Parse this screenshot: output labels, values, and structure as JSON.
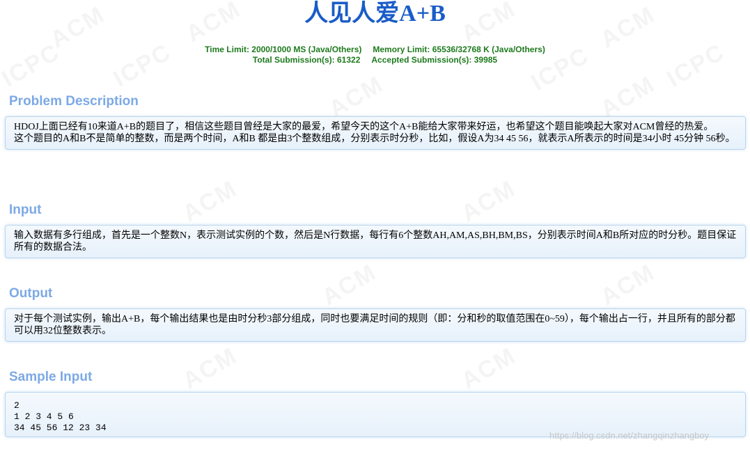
{
  "header": {
    "title": "人见人爱A+B",
    "time_limit": "Time Limit: 2000/1000 MS (Java/Others)",
    "memory_limit": "Memory Limit: 65536/32768 K (Java/Others)",
    "total_submissions": "Total Submission(s): 61322",
    "accepted_submissions": "Accepted Submission(s): 39985"
  },
  "description": {
    "title": "Problem Description",
    "line1": "HDOJ上面已经有10来道A+B的题目了，相信这些题目曾经是大家的最爱，希望今天的这个A+B能给大家带来好运，也希望这个题目能唤起大家对ACM曾经的热爱。",
    "line2": "这个题目的A和B不是简单的整数，而是两个时间，A和B 都是由3个整数组成，分别表示时分秒，比如，假设A为34 45 56，就表示A所表示的时间是34小时 45分钟 56秒。"
  },
  "input": {
    "title": "Input",
    "text": "输入数据有多行组成，首先是一个整数N，表示测试实例的个数，然后是N行数据，每行有6个整数AH,AM,AS,BH,BM,BS，分别表示时间A和B所对应的时分秒。题目保证所有的数据合法。"
  },
  "output": {
    "title": "Output",
    "text": "对于每个测试实例，输出A+B，每个输出结果也是由时分秒3部分组成，同时也要满足时间的规则（即：分和秒的取值范围在0~59），每个输出占一行，并且所有的部分都可以用32位整数表示。"
  },
  "sample_input": {
    "title": "Sample Input",
    "lines": [
      "2",
      "1 2 3 4 5 6",
      "34 45 56 12 23 34"
    ]
  },
  "watermark": {
    "words": [
      "ACM",
      "ICPC"
    ],
    "credit": "https://blog.csdn.net/zhangqinzhangboy"
  }
}
